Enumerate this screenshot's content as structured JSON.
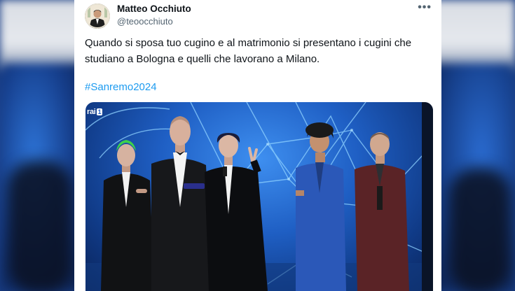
{
  "tweet": {
    "author_name": "Matteo Occhiuto",
    "author_handle": "@teoocchiuto",
    "more_icon": "more-horizontal-icon",
    "text": "Quando si sposa tuo cugino e al matrimonio si presentano i cugini che studiano a Bologna e quelli che lavorano a Milano.",
    "hashtag": "#Sanremo2024"
  },
  "photo": {
    "channel_logo": "rai",
    "channel_number": "1"
  },
  "colors": {
    "hashtag": "#1d9bf0",
    "name": "#0f1419",
    "handle": "#536471",
    "stage_blue": "#1f5fc4"
  }
}
